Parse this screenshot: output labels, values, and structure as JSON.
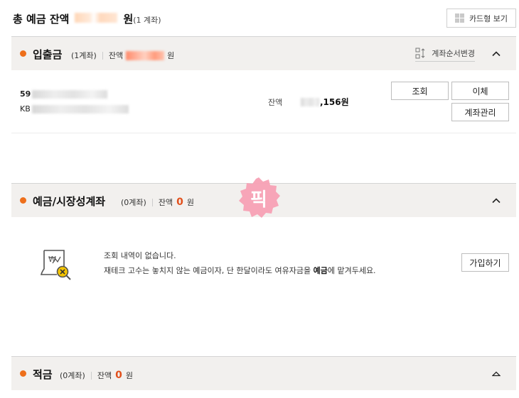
{
  "header": {
    "title": "총 예금 잔액",
    "currency": "원",
    "account_count": "(1 계좌)",
    "card_view_label": "카드형 보기"
  },
  "sections": {
    "deposit": {
      "name": "입출금",
      "count": "(1계좌)",
      "balance_label": "잔액",
      "balance_suffix": "원",
      "reorder_label": "계좌순서변경",
      "account": {
        "number_prefix": "59",
        "bank_prefix": "KB",
        "balance_label": "잔액",
        "balance_visible": ",156원",
        "inquiry_label": "조회",
        "transfer_label": "이체",
        "manage_label": "계좌관리"
      }
    },
    "savings": {
      "name": "예금/시장성계좌",
      "count": "(0계좌)",
      "balance_label": "잔액",
      "balance_value": "0",
      "balance_suffix": "원",
      "empty_line1": "조회 내역이 없습니다.",
      "empty_line2_pre": "재테크 고수는 놓치지 않는 예금이자, 단 한달이라도 여유자금을 ",
      "empty_line2_bold": "예금",
      "empty_line2_post": "에 맡겨두세요.",
      "join_label": "가입하기"
    },
    "installment": {
      "name": "적금",
      "count": "(0계좌)",
      "balance_label": "잔액",
      "balance_value": "0",
      "balance_suffix": "원"
    }
  },
  "sticker_text": "픽",
  "colors": {
    "accent_orange": "#ee6f1b",
    "zero_red": "#e2501c",
    "section_bg": "#f2f0ee",
    "sticker_pink": "#f7a0b4"
  }
}
